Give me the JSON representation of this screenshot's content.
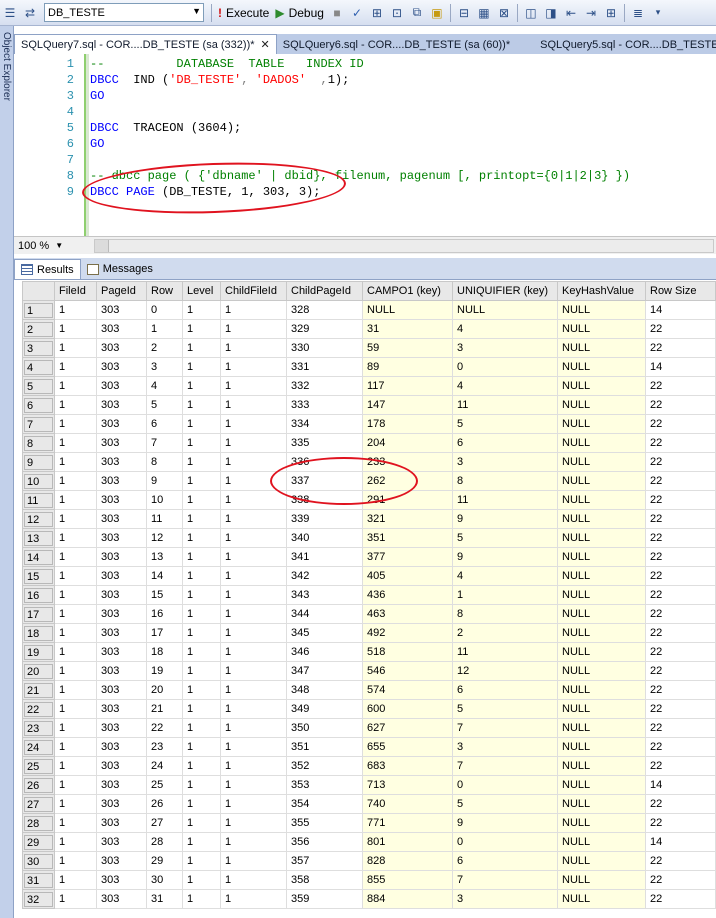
{
  "toolbar": {
    "database": "DB_TESTE",
    "execute_label": "Execute",
    "debug_label": "Debug"
  },
  "sidebar": {
    "label": "Object Explorer"
  },
  "tabs": [
    {
      "label": "SQLQuery7.sql - COR....DB_TESTE (sa (332))*"
    },
    {
      "label": "SQLQuery6.sql - COR....DB_TESTE (sa (60))*"
    },
    {
      "label": "SQLQuery5.sql - COR....DB_TESTE (sa"
    }
  ],
  "editor": {
    "line_numbers": [
      "1",
      "2",
      "3",
      "4",
      "5",
      "6",
      "7",
      "8",
      "9"
    ],
    "lines": [
      {
        "parts": [
          [
            "cm",
            "--          DATABASE  TABLE   INDEX ID"
          ]
        ]
      },
      {
        "parts": [
          [
            "kw",
            "DBCC"
          ],
          [
            "",
            "  IND ("
          ],
          [
            "str",
            "'DB_TESTE'"
          ],
          [
            "gr",
            ", "
          ],
          [
            "str",
            "'DADOS'"
          ],
          [
            "gr",
            "  ,"
          ],
          [
            "",
            "1);"
          ]
        ]
      },
      {
        "parts": [
          [
            "kw",
            "GO"
          ]
        ]
      },
      {
        "parts": []
      },
      {
        "parts": [
          [
            "kw",
            "DBCC"
          ],
          [
            "",
            "  TRACEON (3604);"
          ]
        ]
      },
      {
        "parts": [
          [
            "kw",
            "GO"
          ]
        ]
      },
      {
        "parts": []
      },
      {
        "parts": [
          [
            "cm",
            "-- dbcc page ( {'dbname' | dbid}, filenum, pagenum [, printopt={0|1|2|3} })"
          ]
        ]
      },
      {
        "parts": [
          [
            "kw",
            "DBCC"
          ],
          [
            "",
            ""
          ],
          [
            "kw",
            " PAGE"
          ],
          [
            "",
            " (DB_TESTE, 1, 303, 3);"
          ]
        ]
      }
    ]
  },
  "zoom": "100 %",
  "results_tabs": {
    "results": "Results",
    "messages": "Messages"
  },
  "grid": {
    "columns": [
      "FileId",
      "PageId",
      "Row",
      "Level",
      "ChildFileId",
      "ChildPageId",
      "CAMPO1 (key)",
      "UNIQUIFIER (key)",
      "KeyHashValue",
      "Row Size"
    ],
    "rows": [
      [
        "1",
        "1",
        "303",
        "0",
        "1",
        "1",
        "328",
        "NULL",
        "NULL",
        "NULL",
        "14"
      ],
      [
        "2",
        "1",
        "303",
        "1",
        "1",
        "1",
        "329",
        "31",
        "4",
        "NULL",
        "22"
      ],
      [
        "3",
        "1",
        "303",
        "2",
        "1",
        "1",
        "330",
        "59",
        "3",
        "NULL",
        "22"
      ],
      [
        "4",
        "1",
        "303",
        "3",
        "1",
        "1",
        "331",
        "89",
        "0",
        "NULL",
        "14"
      ],
      [
        "5",
        "1",
        "303",
        "4",
        "1",
        "1",
        "332",
        "117",
        "4",
        "NULL",
        "22"
      ],
      [
        "6",
        "1",
        "303",
        "5",
        "1",
        "1",
        "333",
        "147",
        "11",
        "NULL",
        "22"
      ],
      [
        "7",
        "1",
        "303",
        "6",
        "1",
        "1",
        "334",
        "178",
        "5",
        "NULL",
        "22"
      ],
      [
        "8",
        "1",
        "303",
        "7",
        "1",
        "1",
        "335",
        "204",
        "6",
        "NULL",
        "22"
      ],
      [
        "9",
        "1",
        "303",
        "8",
        "1",
        "1",
        "336",
        "233",
        "3",
        "NULL",
        "22"
      ],
      [
        "10",
        "1",
        "303",
        "9",
        "1",
        "1",
        "337",
        "262",
        "8",
        "NULL",
        "22"
      ],
      [
        "11",
        "1",
        "303",
        "10",
        "1",
        "1",
        "338",
        "291",
        "11",
        "NULL",
        "22"
      ],
      [
        "12",
        "1",
        "303",
        "11",
        "1",
        "1",
        "339",
        "321",
        "9",
        "NULL",
        "22"
      ],
      [
        "13",
        "1",
        "303",
        "12",
        "1",
        "1",
        "340",
        "351",
        "5",
        "NULL",
        "22"
      ],
      [
        "14",
        "1",
        "303",
        "13",
        "1",
        "1",
        "341",
        "377",
        "9",
        "NULL",
        "22"
      ],
      [
        "15",
        "1",
        "303",
        "14",
        "1",
        "1",
        "342",
        "405",
        "4",
        "NULL",
        "22"
      ],
      [
        "16",
        "1",
        "303",
        "15",
        "1",
        "1",
        "343",
        "436",
        "1",
        "NULL",
        "22"
      ],
      [
        "17",
        "1",
        "303",
        "16",
        "1",
        "1",
        "344",
        "463",
        "8",
        "NULL",
        "22"
      ],
      [
        "18",
        "1",
        "303",
        "17",
        "1",
        "1",
        "345",
        "492",
        "2",
        "NULL",
        "22"
      ],
      [
        "19",
        "1",
        "303",
        "18",
        "1",
        "1",
        "346",
        "518",
        "11",
        "NULL",
        "22"
      ],
      [
        "20",
        "1",
        "303",
        "19",
        "1",
        "1",
        "347",
        "546",
        "12",
        "NULL",
        "22"
      ],
      [
        "21",
        "1",
        "303",
        "20",
        "1",
        "1",
        "348",
        "574",
        "6",
        "NULL",
        "22"
      ],
      [
        "22",
        "1",
        "303",
        "21",
        "1",
        "1",
        "349",
        "600",
        "5",
        "NULL",
        "22"
      ],
      [
        "23",
        "1",
        "303",
        "22",
        "1",
        "1",
        "350",
        "627",
        "7",
        "NULL",
        "22"
      ],
      [
        "24",
        "1",
        "303",
        "23",
        "1",
        "1",
        "351",
        "655",
        "3",
        "NULL",
        "22"
      ],
      [
        "25",
        "1",
        "303",
        "24",
        "1",
        "1",
        "352",
        "683",
        "7",
        "NULL",
        "22"
      ],
      [
        "26",
        "1",
        "303",
        "25",
        "1",
        "1",
        "353",
        "713",
        "0",
        "NULL",
        "14"
      ],
      [
        "27",
        "1",
        "303",
        "26",
        "1",
        "1",
        "354",
        "740",
        "5",
        "NULL",
        "22"
      ],
      [
        "28",
        "1",
        "303",
        "27",
        "1",
        "1",
        "355",
        "771",
        "9",
        "NULL",
        "22"
      ],
      [
        "29",
        "1",
        "303",
        "28",
        "1",
        "1",
        "356",
        "801",
        "0",
        "NULL",
        "14"
      ],
      [
        "30",
        "1",
        "303",
        "29",
        "1",
        "1",
        "357",
        "828",
        "6",
        "NULL",
        "22"
      ],
      [
        "31",
        "1",
        "303",
        "30",
        "1",
        "1",
        "358",
        "855",
        "7",
        "NULL",
        "22"
      ],
      [
        "32",
        "1",
        "303",
        "31",
        "1",
        "1",
        "359",
        "884",
        "3",
        "NULL",
        "22"
      ]
    ]
  },
  "colors": {
    "annotation": "#e0131f",
    "key_highlight": "#ffffe1"
  }
}
